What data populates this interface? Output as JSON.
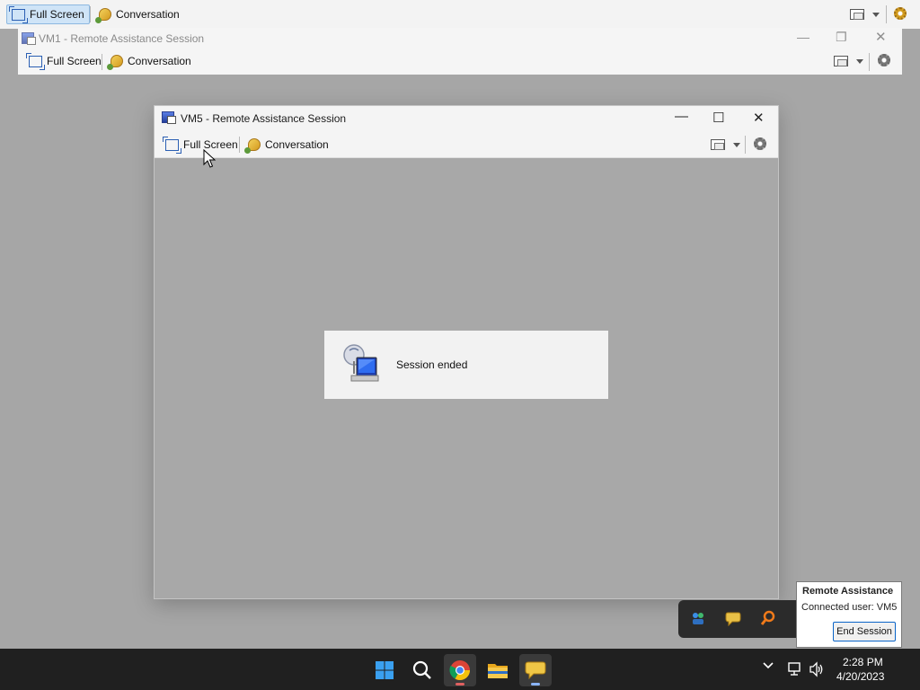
{
  "outer_toolbar": {
    "full_screen_label": "Full Screen",
    "conversation_label": "Conversation"
  },
  "vm1_window": {
    "title": "VM1 - Remote Assistance Session",
    "full_screen_label": "Full Screen",
    "conversation_label": "Conversation"
  },
  "vm5_window": {
    "title": "VM5 - Remote Assistance Session",
    "full_screen_label": "Full Screen",
    "conversation_label": "Conversation",
    "minimize": "—",
    "maximize": "☐",
    "close": "✕"
  },
  "session_dialog": {
    "message": "Session ended"
  },
  "ra_tooltip": {
    "title": "Remote Assistance",
    "connected_user": "Connected user:  VM5",
    "end_session_label": "End Session"
  },
  "taskbar": {
    "time": "2:28 PM",
    "date": "4/20/2023",
    "chevron": "⌄"
  },
  "colors": {
    "desktop": "#a6a6a6",
    "taskbar": "#202020",
    "accent": "#0a64c8"
  }
}
